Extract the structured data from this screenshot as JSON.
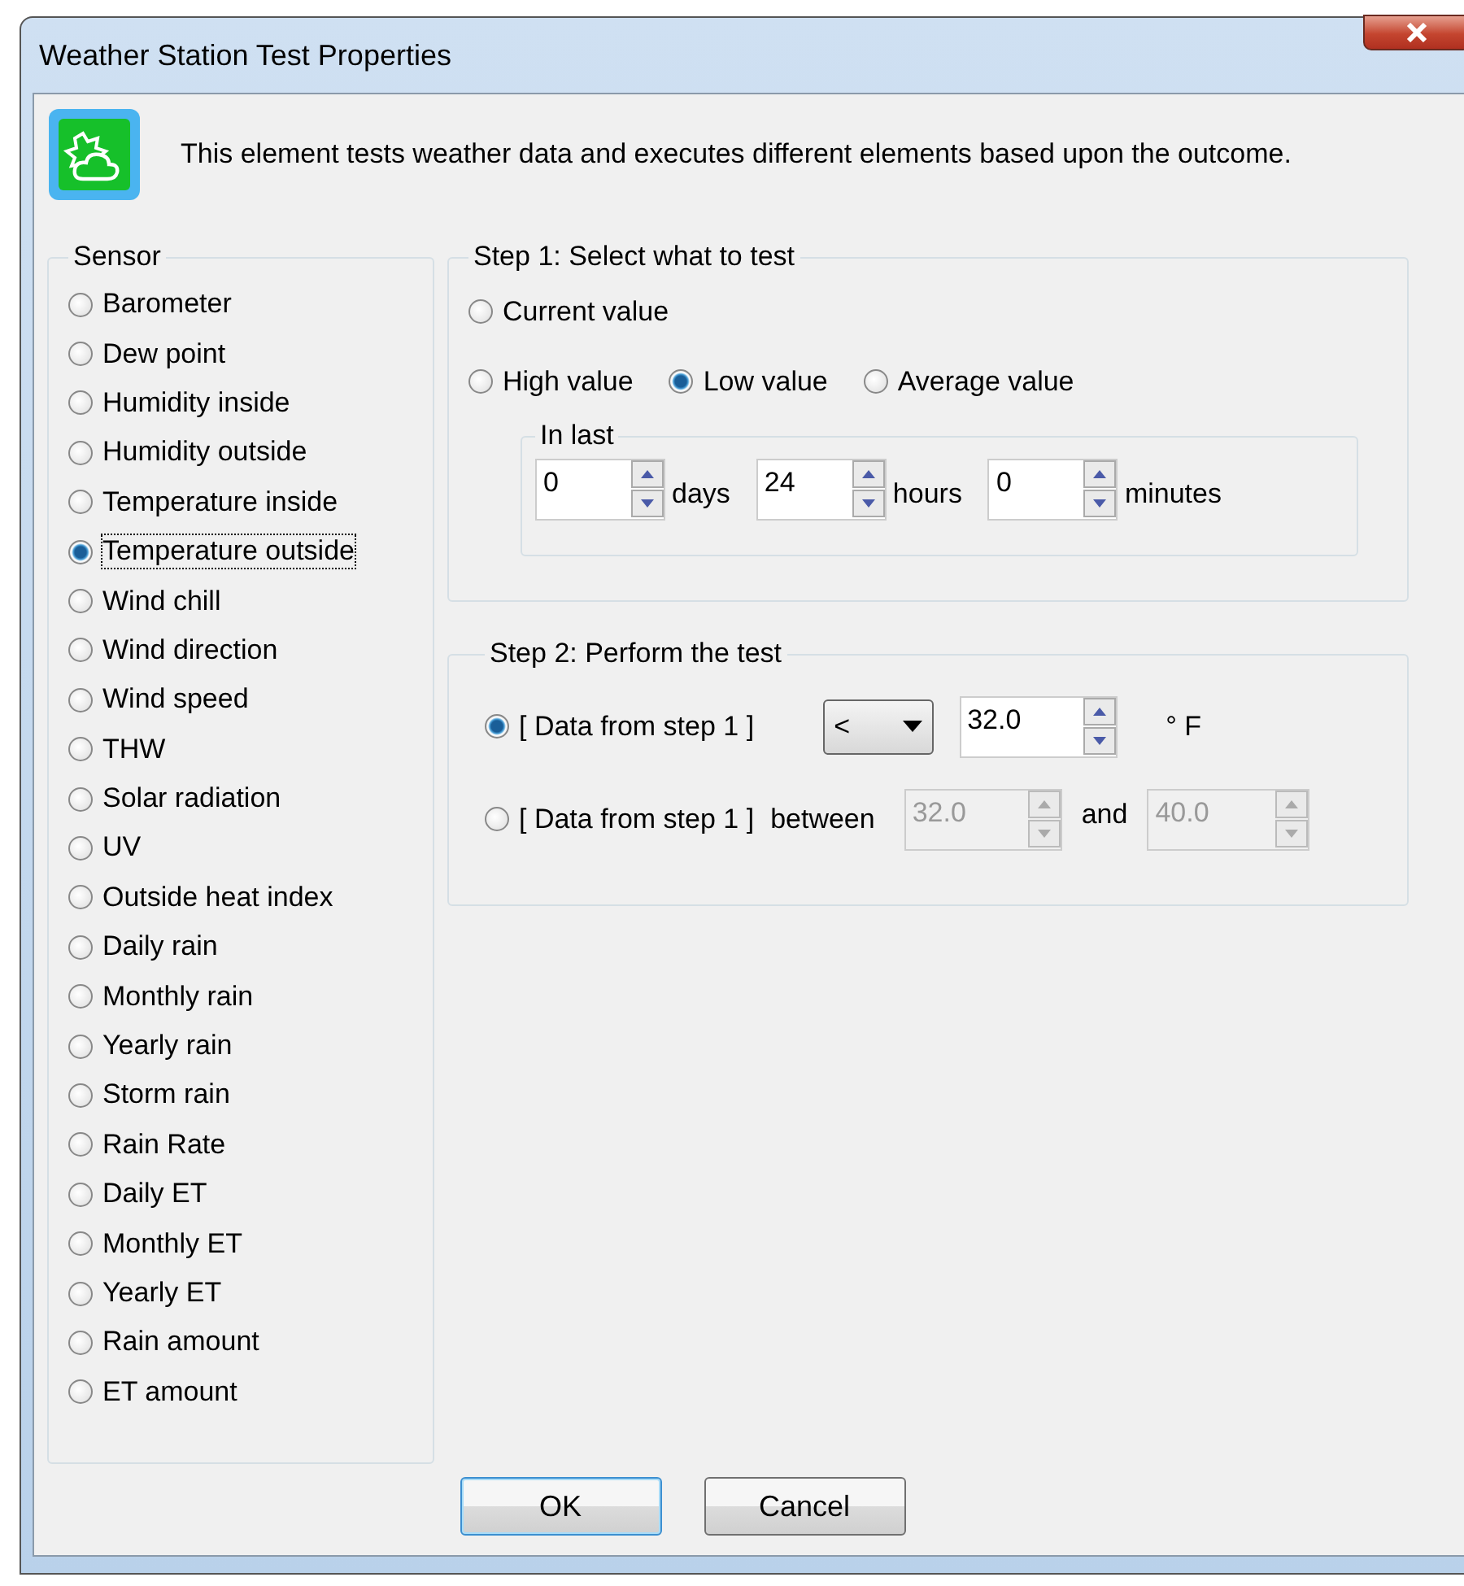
{
  "window": {
    "title": "Weather Station Test Properties"
  },
  "description": "This element tests weather data and executes different elements based upon the outcome.",
  "sensor": {
    "title": "Sensor",
    "items": [
      {
        "label": "Barometer",
        "selected": false
      },
      {
        "label": "Dew point",
        "selected": false
      },
      {
        "label": "Humidity inside",
        "selected": false
      },
      {
        "label": "Humidity outside",
        "selected": false
      },
      {
        "label": "Temperature inside",
        "selected": false
      },
      {
        "label": "Temperature outside",
        "selected": true
      },
      {
        "label": "Wind chill",
        "selected": false
      },
      {
        "label": "Wind direction",
        "selected": false
      },
      {
        "label": "Wind speed",
        "selected": false
      },
      {
        "label": "THW",
        "selected": false
      },
      {
        "label": "Solar radiation",
        "selected": false
      },
      {
        "label": "UV",
        "selected": false
      },
      {
        "label": "Outside heat index",
        "selected": false
      },
      {
        "label": "Daily rain",
        "selected": false
      },
      {
        "label": "Monthly rain",
        "selected": false
      },
      {
        "label": "Yearly rain",
        "selected": false
      },
      {
        "label": "Storm rain",
        "selected": false
      },
      {
        "label": "Rain Rate",
        "selected": false
      },
      {
        "label": "Daily ET",
        "selected": false
      },
      {
        "label": "Monthly ET",
        "selected": false
      },
      {
        "label": "Yearly ET",
        "selected": false
      },
      {
        "label": "Rain amount",
        "selected": false
      },
      {
        "label": "ET amount",
        "selected": false
      }
    ]
  },
  "step1": {
    "title": "Step 1: Select what to test",
    "option_rows": [
      {
        "options": [
          {
            "label": "Current value",
            "selected": false
          }
        ]
      },
      {
        "options": [
          {
            "label": "High value",
            "selected": false
          },
          {
            "label": "Low value",
            "selected": true
          },
          {
            "label": "Average value",
            "selected": false
          }
        ]
      }
    ],
    "in_last": {
      "title": "In last",
      "fields": [
        {
          "value": "0",
          "unit": "days"
        },
        {
          "value": "24",
          "unit": "hours"
        },
        {
          "value": "0",
          "unit": "minutes"
        }
      ]
    }
  },
  "step2": {
    "title": "Step 2: Perform the test",
    "rows": [
      {
        "kind": "compare",
        "selected": true,
        "label": "[ Data from step 1 ]",
        "operator": "<",
        "value": "32.0",
        "disabled": false,
        "unit": "° F"
      },
      {
        "kind": "between",
        "selected": false,
        "label": "[ Data from step 1 ]",
        "between": "between",
        "value": "32.0",
        "and": "and",
        "value2": "40.0",
        "disabled": true
      }
    ]
  },
  "buttons": [
    {
      "label": "OK",
      "default": true
    },
    {
      "label": "Cancel",
      "default": false
    }
  ]
}
